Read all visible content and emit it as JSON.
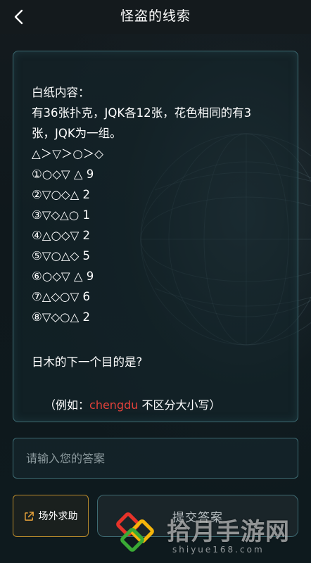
{
  "header": {
    "title": "怪盗的线索",
    "back_icon": "chevron-left-icon"
  },
  "clue": {
    "lines": [
      "白纸内容：",
      "有36张扑克，JQK各12张，花色相同的有3",
      "张，JQK为一组。",
      "△＞▽＞○＞◇",
      "①○◇▽ △  9",
      "②▽○◇△  2",
      "③▽◇△○  1",
      "④△○◇▽  2",
      "⑤▽○△◇  5",
      "⑥○◇▽ △  9",
      "⑦△◇○▽  6",
      "⑧▽◇○△  2"
    ],
    "question": "日木的下一个目的是?",
    "example_prefix": "（例如：",
    "example_highlight": "chengdu",
    "example_suffix": " 不区分大小写）",
    "highlight_color": "#e0413a"
  },
  "answer": {
    "placeholder": "请输入您的答案",
    "value": ""
  },
  "buttons": {
    "help_label": "场外求助",
    "help_icon": "share-icon",
    "submit_label": "提交答案"
  },
  "watermark": {
    "text": "拾月手游网",
    "domain": "shiyue168.com"
  }
}
